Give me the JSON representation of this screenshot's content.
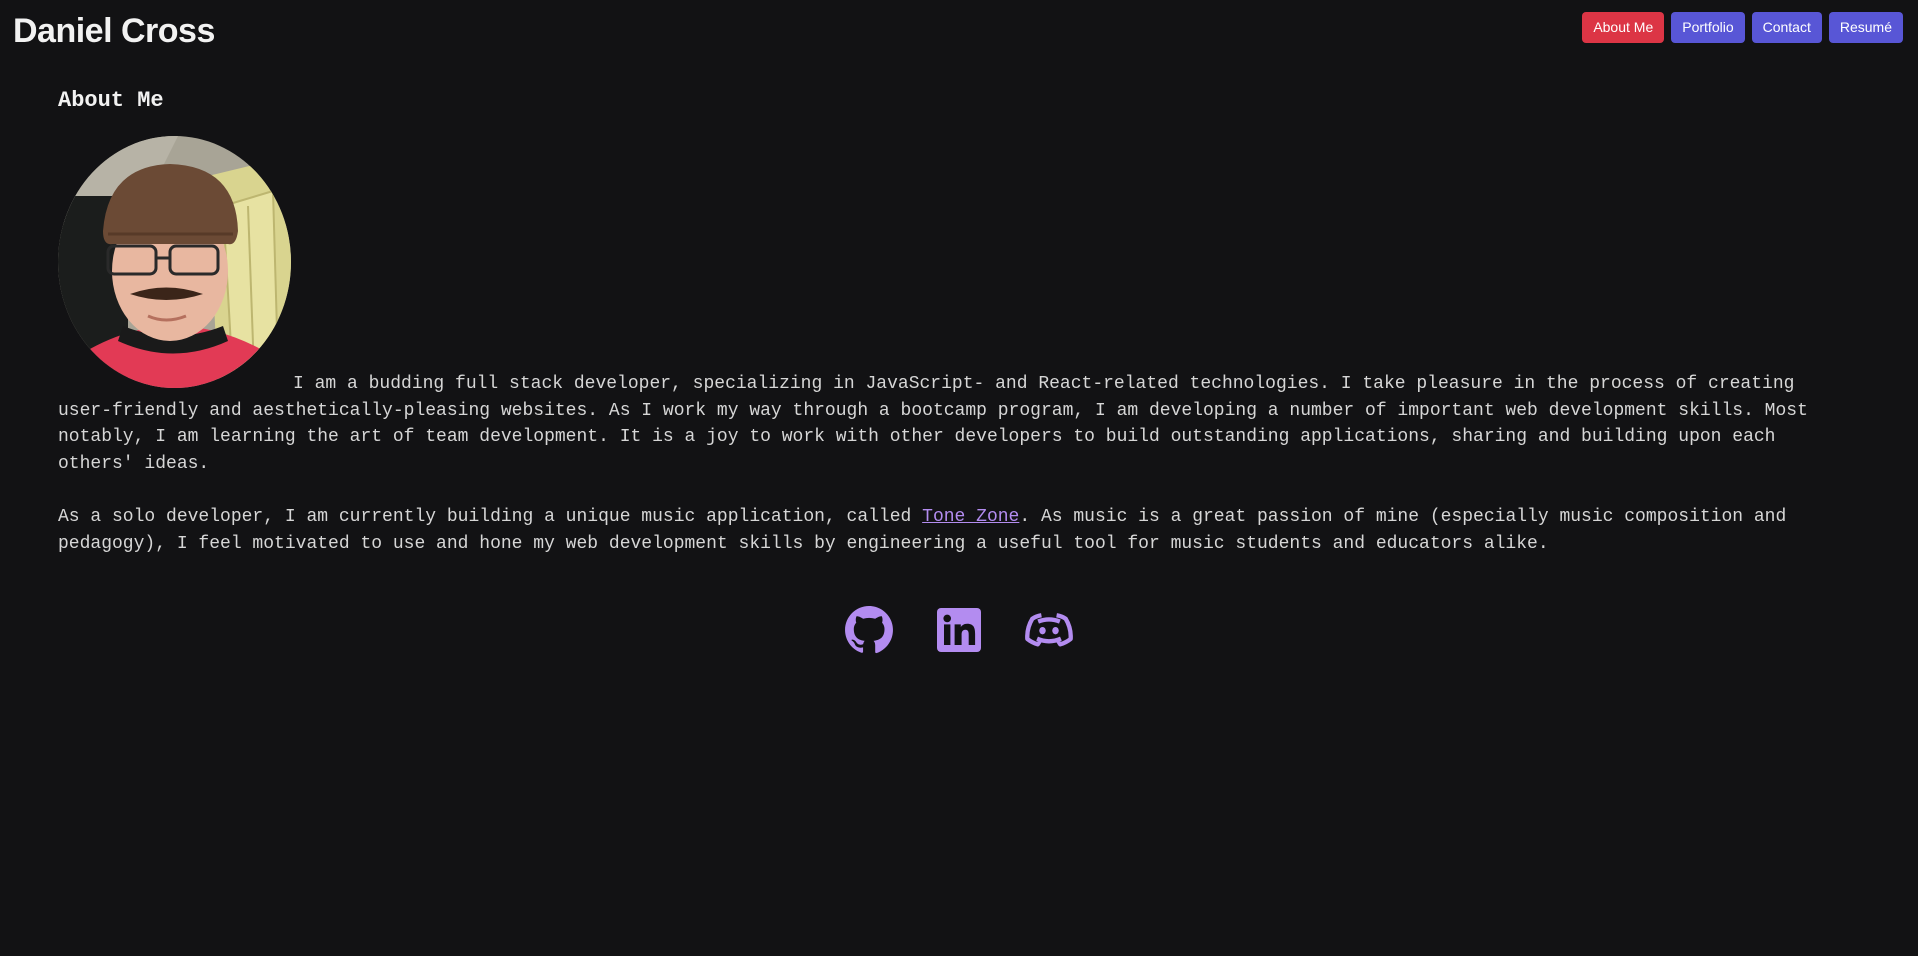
{
  "header": {
    "title": "Daniel Cross",
    "nav": [
      {
        "label": "About Me",
        "active": true
      },
      {
        "label": "Portfolio",
        "active": false
      },
      {
        "label": "Contact",
        "active": false
      },
      {
        "label": "Resumé",
        "active": false
      }
    ]
  },
  "main": {
    "section_title": "About Me",
    "paragraph1": "I am a budding full stack developer, specializing in JavaScript- and React-related technologies. I take pleasure in the process of creating user-friendly and aesthetically-pleasing websites. As I work my way through a bootcamp program, I am developing a number of important web development skills. Most notably, I am learning the art of team development. It is a joy to work with other developers to build outstanding applications, sharing and building upon each others' ideas.",
    "paragraph2_before": "As a solo developer, I am currently building a unique music application, called ",
    "paragraph2_link": "Tone Zone",
    "paragraph2_after": ". As music is a great passion of mine (especially music composition and pedagogy), I feel motivated to use and hone my web development skills by engineering a useful tool for music students and educators alike."
  },
  "socials": [
    {
      "icon": "github-icon"
    },
    {
      "icon": "linkedin-icon"
    },
    {
      "icon": "discord-icon"
    }
  ],
  "colors": {
    "background": "#121214",
    "nav_active": "#dc3545",
    "nav_inactive": "#5856d6",
    "accent": "#b38cf0"
  }
}
